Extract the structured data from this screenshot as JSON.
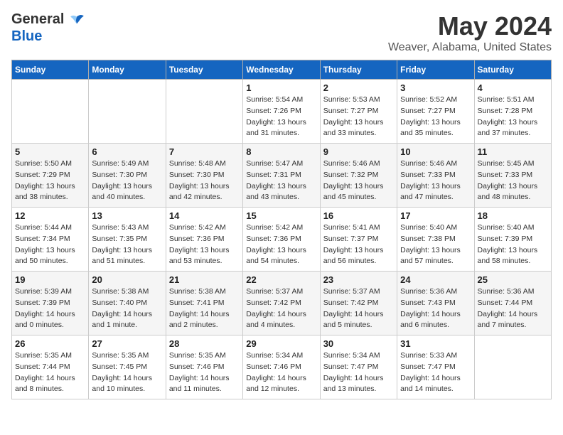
{
  "header": {
    "logo_general": "General",
    "logo_blue": "Blue",
    "month": "May 2024",
    "location": "Weaver, Alabama, United States"
  },
  "days_of_week": [
    "Sunday",
    "Monday",
    "Tuesday",
    "Wednesday",
    "Thursday",
    "Friday",
    "Saturday"
  ],
  "weeks": [
    [
      {
        "day": "",
        "sunrise": "",
        "sunset": "",
        "daylight": ""
      },
      {
        "day": "",
        "sunrise": "",
        "sunset": "",
        "daylight": ""
      },
      {
        "day": "",
        "sunrise": "",
        "sunset": "",
        "daylight": ""
      },
      {
        "day": "1",
        "sunrise": "Sunrise: 5:54 AM",
        "sunset": "Sunset: 7:26 PM",
        "daylight": "Daylight: 13 hours and 31 minutes."
      },
      {
        "day": "2",
        "sunrise": "Sunrise: 5:53 AM",
        "sunset": "Sunset: 7:27 PM",
        "daylight": "Daylight: 13 hours and 33 minutes."
      },
      {
        "day": "3",
        "sunrise": "Sunrise: 5:52 AM",
        "sunset": "Sunset: 7:27 PM",
        "daylight": "Daylight: 13 hours and 35 minutes."
      },
      {
        "day": "4",
        "sunrise": "Sunrise: 5:51 AM",
        "sunset": "Sunset: 7:28 PM",
        "daylight": "Daylight: 13 hours and 37 minutes."
      }
    ],
    [
      {
        "day": "5",
        "sunrise": "Sunrise: 5:50 AM",
        "sunset": "Sunset: 7:29 PM",
        "daylight": "Daylight: 13 hours and 38 minutes."
      },
      {
        "day": "6",
        "sunrise": "Sunrise: 5:49 AM",
        "sunset": "Sunset: 7:30 PM",
        "daylight": "Daylight: 13 hours and 40 minutes."
      },
      {
        "day": "7",
        "sunrise": "Sunrise: 5:48 AM",
        "sunset": "Sunset: 7:30 PM",
        "daylight": "Daylight: 13 hours and 42 minutes."
      },
      {
        "day": "8",
        "sunrise": "Sunrise: 5:47 AM",
        "sunset": "Sunset: 7:31 PM",
        "daylight": "Daylight: 13 hours and 43 minutes."
      },
      {
        "day": "9",
        "sunrise": "Sunrise: 5:46 AM",
        "sunset": "Sunset: 7:32 PM",
        "daylight": "Daylight: 13 hours and 45 minutes."
      },
      {
        "day": "10",
        "sunrise": "Sunrise: 5:46 AM",
        "sunset": "Sunset: 7:33 PM",
        "daylight": "Daylight: 13 hours and 47 minutes."
      },
      {
        "day": "11",
        "sunrise": "Sunrise: 5:45 AM",
        "sunset": "Sunset: 7:33 PM",
        "daylight": "Daylight: 13 hours and 48 minutes."
      }
    ],
    [
      {
        "day": "12",
        "sunrise": "Sunrise: 5:44 AM",
        "sunset": "Sunset: 7:34 PM",
        "daylight": "Daylight: 13 hours and 50 minutes."
      },
      {
        "day": "13",
        "sunrise": "Sunrise: 5:43 AM",
        "sunset": "Sunset: 7:35 PM",
        "daylight": "Daylight: 13 hours and 51 minutes."
      },
      {
        "day": "14",
        "sunrise": "Sunrise: 5:42 AM",
        "sunset": "Sunset: 7:36 PM",
        "daylight": "Daylight: 13 hours and 53 minutes."
      },
      {
        "day": "15",
        "sunrise": "Sunrise: 5:42 AM",
        "sunset": "Sunset: 7:36 PM",
        "daylight": "Daylight: 13 hours and 54 minutes."
      },
      {
        "day": "16",
        "sunrise": "Sunrise: 5:41 AM",
        "sunset": "Sunset: 7:37 PM",
        "daylight": "Daylight: 13 hours and 56 minutes."
      },
      {
        "day": "17",
        "sunrise": "Sunrise: 5:40 AM",
        "sunset": "Sunset: 7:38 PM",
        "daylight": "Daylight: 13 hours and 57 minutes."
      },
      {
        "day": "18",
        "sunrise": "Sunrise: 5:40 AM",
        "sunset": "Sunset: 7:39 PM",
        "daylight": "Daylight: 13 hours and 58 minutes."
      }
    ],
    [
      {
        "day": "19",
        "sunrise": "Sunrise: 5:39 AM",
        "sunset": "Sunset: 7:39 PM",
        "daylight": "Daylight: 14 hours and 0 minutes."
      },
      {
        "day": "20",
        "sunrise": "Sunrise: 5:38 AM",
        "sunset": "Sunset: 7:40 PM",
        "daylight": "Daylight: 14 hours and 1 minute."
      },
      {
        "day": "21",
        "sunrise": "Sunrise: 5:38 AM",
        "sunset": "Sunset: 7:41 PM",
        "daylight": "Daylight: 14 hours and 2 minutes."
      },
      {
        "day": "22",
        "sunrise": "Sunrise: 5:37 AM",
        "sunset": "Sunset: 7:42 PM",
        "daylight": "Daylight: 14 hours and 4 minutes."
      },
      {
        "day": "23",
        "sunrise": "Sunrise: 5:37 AM",
        "sunset": "Sunset: 7:42 PM",
        "daylight": "Daylight: 14 hours and 5 minutes."
      },
      {
        "day": "24",
        "sunrise": "Sunrise: 5:36 AM",
        "sunset": "Sunset: 7:43 PM",
        "daylight": "Daylight: 14 hours and 6 minutes."
      },
      {
        "day": "25",
        "sunrise": "Sunrise: 5:36 AM",
        "sunset": "Sunset: 7:44 PM",
        "daylight": "Daylight: 14 hours and 7 minutes."
      }
    ],
    [
      {
        "day": "26",
        "sunrise": "Sunrise: 5:35 AM",
        "sunset": "Sunset: 7:44 PM",
        "daylight": "Daylight: 14 hours and 8 minutes."
      },
      {
        "day": "27",
        "sunrise": "Sunrise: 5:35 AM",
        "sunset": "Sunset: 7:45 PM",
        "daylight": "Daylight: 14 hours and 10 minutes."
      },
      {
        "day": "28",
        "sunrise": "Sunrise: 5:35 AM",
        "sunset": "Sunset: 7:46 PM",
        "daylight": "Daylight: 14 hours and 11 minutes."
      },
      {
        "day": "29",
        "sunrise": "Sunrise: 5:34 AM",
        "sunset": "Sunset: 7:46 PM",
        "daylight": "Daylight: 14 hours and 12 minutes."
      },
      {
        "day": "30",
        "sunrise": "Sunrise: 5:34 AM",
        "sunset": "Sunset: 7:47 PM",
        "daylight": "Daylight: 14 hours and 13 minutes."
      },
      {
        "day": "31",
        "sunrise": "Sunrise: 5:33 AM",
        "sunset": "Sunset: 7:47 PM",
        "daylight": "Daylight: 14 hours and 14 minutes."
      },
      {
        "day": "",
        "sunrise": "",
        "sunset": "",
        "daylight": ""
      }
    ]
  ]
}
